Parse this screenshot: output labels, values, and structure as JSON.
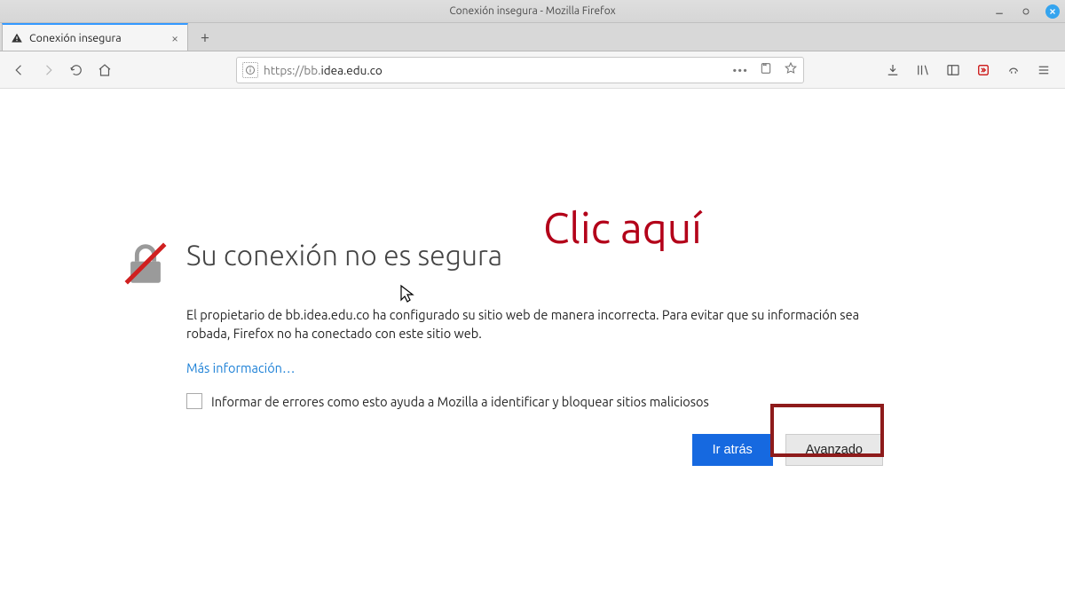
{
  "window": {
    "title": "Conexión insegura - Mozilla Firefox"
  },
  "tab": {
    "title": "Conexión insegura"
  },
  "url": {
    "prefix": "https://bb.",
    "host": "idea.edu.co",
    "suffix": ""
  },
  "error": {
    "heading": "Su conexión no es segura",
    "paragraph": "El propietario de bb.idea.edu.co ha configurado su sitio web de manera incorrecta. Para evitar que su información sea robada, Firefox no ha conectado con este sitio web.",
    "learn_more": "Más información…",
    "report_label": "Informar de errores como esto ayuda a Mozilla a identificar y bloquear sitios maliciosos",
    "back_button": "Ir atrás",
    "advanced_button": "Avanzado"
  },
  "annotation": {
    "text": "Clic aquí"
  }
}
